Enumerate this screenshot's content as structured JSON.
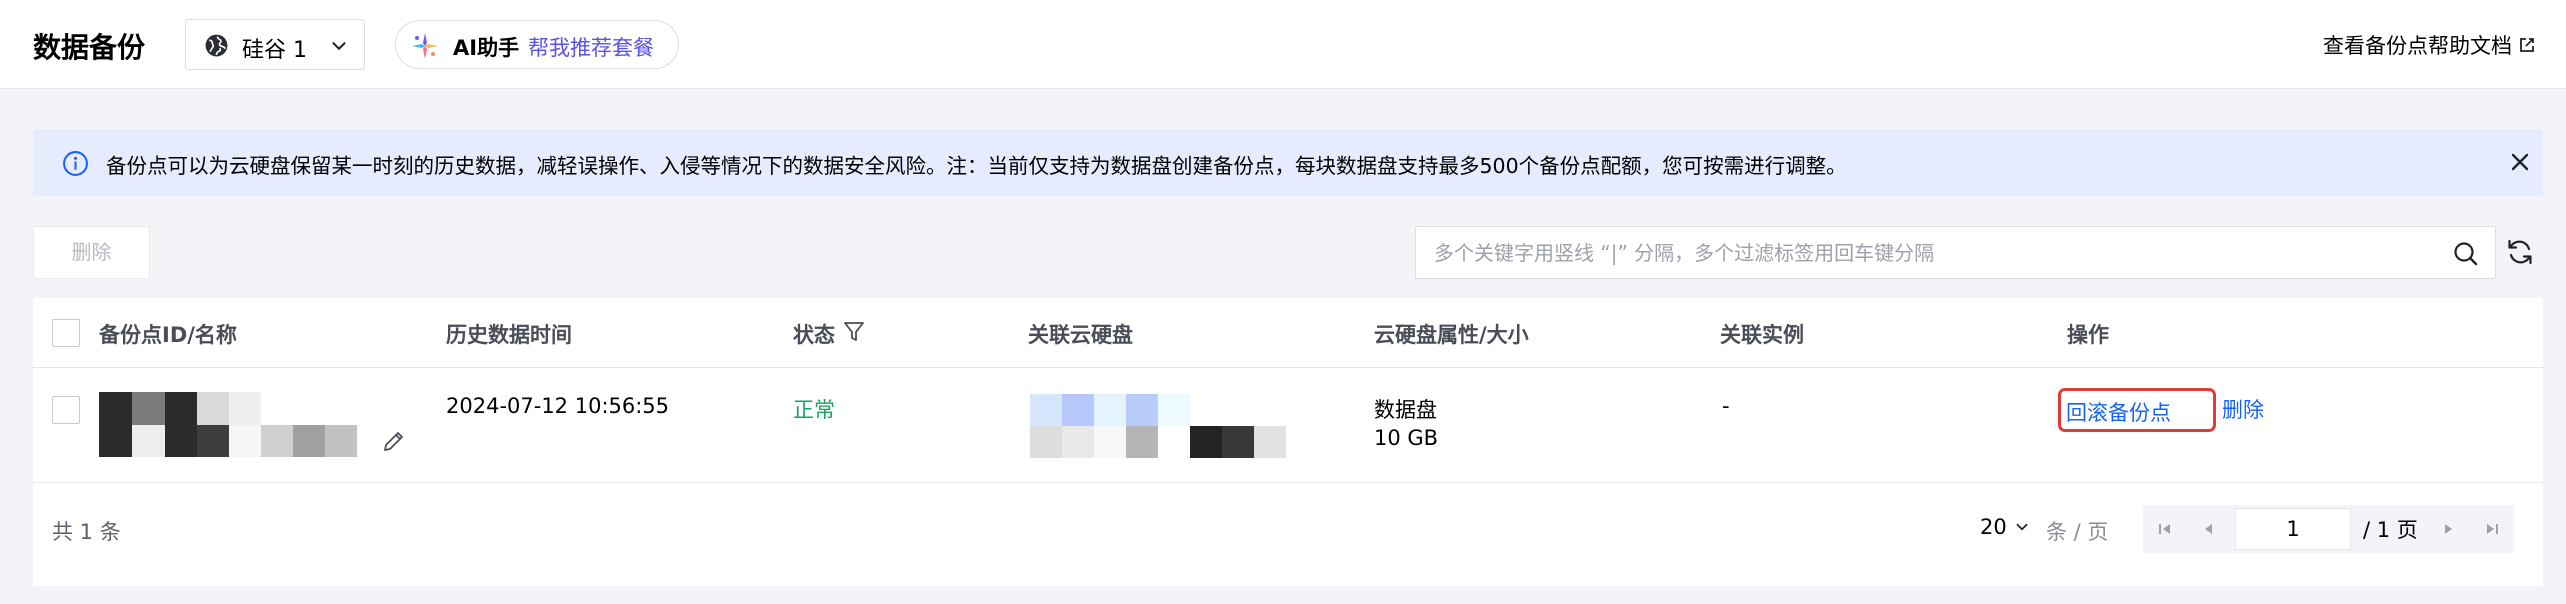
{
  "header": {
    "title": "数据备份",
    "region": "硅谷 1",
    "ai_label": "AI助手",
    "ai_link": "帮我推荐套餐",
    "help_link": "查看备份点帮助文档"
  },
  "banner": {
    "text": "备份点可以为云硬盘保留某一时刻的历史数据，减轻误操作、入侵等情况下的数据安全风险。注：当前仅支持为数据盘创建备份点，每块数据盘支持最多500个备份点配额，您可按需进行调整。"
  },
  "toolbar": {
    "delete_label": "删除",
    "search_placeholder": "多个关键字用竖线 “|” 分隔，多个过滤标签用回车键分隔"
  },
  "table": {
    "columns": {
      "id_name": "备份点ID/名称",
      "history_time": "历史数据时间",
      "status": "状态",
      "disk": "关联云硬盘",
      "disk_attr": "云硬盘属性/大小",
      "instance": "关联实例",
      "actions": "操作"
    },
    "rows": [
      {
        "history_time": "2024-07-12 10:56:55",
        "status": "正常",
        "disk_type": "数据盘",
        "disk_size": "10 GB",
        "instance": "-",
        "action_rollback": "回滚备份点",
        "action_delete": "删除"
      }
    ]
  },
  "pagination": {
    "total": "共 1 条",
    "page_size": "20",
    "per_page_label": "条 / 页",
    "current_page": "1",
    "total_pages": "/ 1 页"
  },
  "colors": {
    "accent": "#1664ff",
    "ai_purple": "#5a4ff0",
    "status_ok": "#1aa35d",
    "highlight_red": "#e33a32",
    "banner_bg": "#e6ecfd"
  }
}
